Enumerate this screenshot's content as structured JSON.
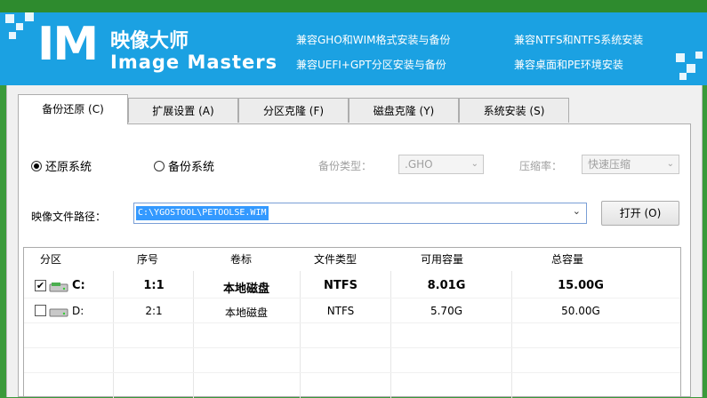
{
  "header": {
    "logo_mark": "IM",
    "name_cn": "映像大师",
    "name_en": "Image Masters",
    "features": [
      "兼容GHO和WIM格式安装与备份",
      "兼容NTFS和NTFS系统安装",
      "兼容UEFI+GPT分区安装与备份",
      "兼容桌面和PE环境安装"
    ]
  },
  "tabs": [
    {
      "label": "备份还原 (C)",
      "active": true
    },
    {
      "label": "扩展设置 (A)",
      "active": false
    },
    {
      "label": "分区克隆 (F)",
      "active": false
    },
    {
      "label": "磁盘克隆 (Y)",
      "active": false
    },
    {
      "label": "系统安装 (S)",
      "active": false
    }
  ],
  "mode": {
    "restore_label": "还原系统",
    "backup_label": "备份系统",
    "selected": "restore"
  },
  "backup_type": {
    "label": "备份类型：",
    "value": ".GHO"
  },
  "compression": {
    "label": "压缩率：",
    "value": "快速压缩"
  },
  "image_path": {
    "label": "映像文件路径：",
    "value": "C:\\YGOSTOOL\\PETOOLSE.WIM"
  },
  "open_button": "打开 (O)",
  "table": {
    "columns": [
      "分区",
      "序号",
      "卷标",
      "文件类型",
      "可用容量",
      "总容量"
    ],
    "rows": [
      {
        "checked": true,
        "drive": "C:",
        "index": "1:1",
        "label": "本地磁盘",
        "fs": "NTFS",
        "free": "8.01G",
        "total": "15.00G"
      },
      {
        "checked": false,
        "drive": "D:",
        "index": "2:1",
        "label": "本地磁盘",
        "fs": "NTFS",
        "free": "5.70G",
        "total": "50.00G"
      }
    ]
  },
  "colors": {
    "header_blue": "#1ba1e2",
    "window_bg": "#f0f0f0",
    "selection": "#3399ff"
  }
}
